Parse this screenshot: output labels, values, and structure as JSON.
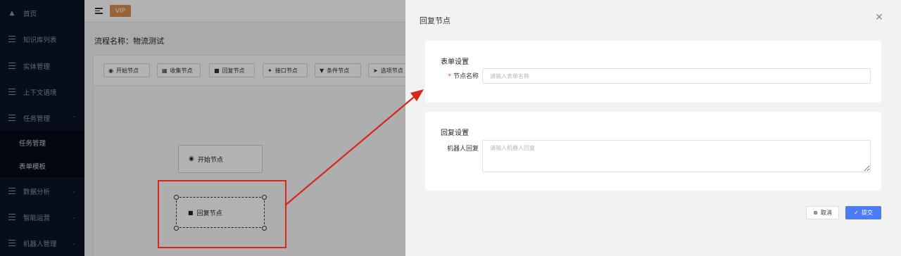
{
  "sidebar": {
    "items": [
      {
        "label": "首页",
        "icon": "home-icon"
      },
      {
        "label": "知识库列表",
        "icon": "menu-lines-icon"
      },
      {
        "label": "实体管理",
        "icon": "menu-lines-icon"
      },
      {
        "label": "上下文语境",
        "icon": "menu-lines-icon"
      },
      {
        "label": "任务管理",
        "icon": "menu-lines-icon",
        "expanded": true
      },
      {
        "label": "数据分析",
        "icon": "menu-lines-icon"
      },
      {
        "label": "智能运营",
        "icon": "menu-lines-icon"
      },
      {
        "label": "机器人管理",
        "icon": "menu-lines-icon"
      }
    ],
    "sub_items": [
      {
        "label": "任务管理"
      },
      {
        "label": "表单模板"
      }
    ]
  },
  "topbar": {
    "vip_label": "VIP"
  },
  "flow": {
    "title": "流程名称：物流测试",
    "toolbar": [
      {
        "label": "开始节点",
        "icon": "play-circle-icon"
      },
      {
        "label": "收集节点",
        "icon": "document-icon"
      },
      {
        "label": "回复节点",
        "icon": "chat-bubble-icon"
      },
      {
        "label": "接口节点",
        "icon": "plug-icon"
      },
      {
        "label": "条件节点",
        "icon": "filter-icon"
      },
      {
        "label": "选项节点",
        "icon": "cursor-icon"
      }
    ],
    "nodes": {
      "start_label": "开始节点",
      "reply_label": "回复节点"
    }
  },
  "drawer": {
    "title": "回复节点",
    "form_section": {
      "heading": "表单设置",
      "field_label": "节点名称",
      "required_mark": "*",
      "placeholder": "请输入表单名称"
    },
    "reply_section": {
      "heading": "回复设置",
      "field_label": "机器人回复",
      "placeholder": "请输入机器人回复"
    },
    "cancel_label": "取消",
    "submit_label": "提交"
  },
  "colors": {
    "sidebar_bg": "#0b1524",
    "vip": "#d9904c",
    "primary": "#4c7cf5",
    "annotation_red": "#d9261c"
  }
}
